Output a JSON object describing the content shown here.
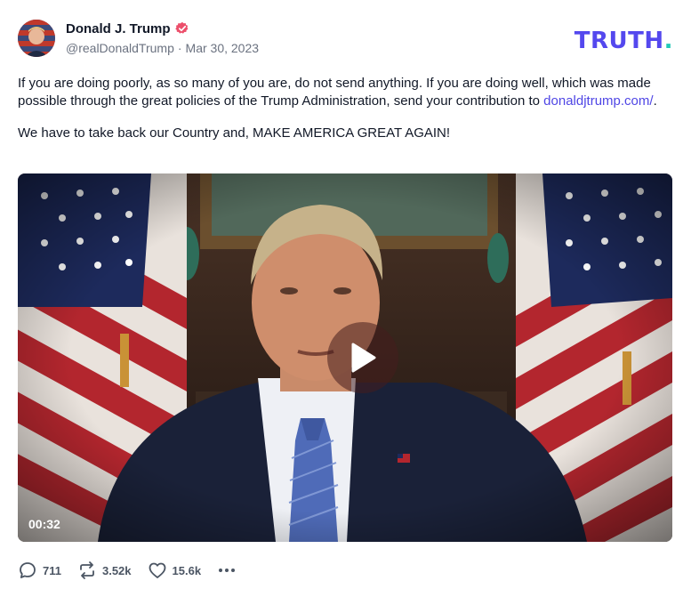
{
  "post": {
    "author": {
      "display_name": "Donald J. Trump",
      "handle": "@realDonaldTrump",
      "separator": "·",
      "date": "Mar 30, 2023",
      "verified": true
    },
    "brand": {
      "logo_text": "TRUTH",
      "logo_dot": ".",
      "primary_color": "#5448ee",
      "accent_color": "#22c9b7"
    },
    "paragraph_1": "If you are doing poorly, as so many of you are, do not send anything. If you are doing well, which was made possible through the great policies of the Trump Administration, send your contribution to",
    "link_text": "donaldjtrump.com/",
    "paragraph_1_end": ".",
    "paragraph_2": "We have to take back our Country and, MAKE AMERICA GREAT AGAIN!",
    "video": {
      "duration": "00:32",
      "play_icon": "play-icon"
    },
    "actions": {
      "reply_count": "711",
      "retruth_count": "3.52k",
      "like_count": "15.6k",
      "reply_icon": "speech-bubble-icon",
      "retruth_icon": "repost-icon",
      "like_icon": "heart-icon",
      "more_icon": "ellipsis-icon"
    }
  }
}
